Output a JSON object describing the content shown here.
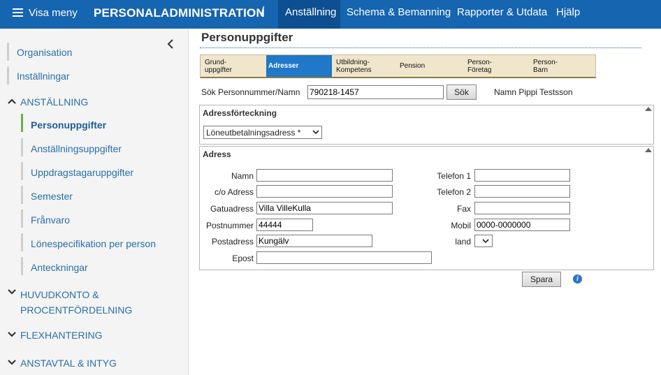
{
  "topbar": {
    "menu_label": "Visa meny",
    "app_title": "PERSONALADMINISTRATION",
    "separator": "/",
    "nav": [
      "Anställning",
      "Schema & Bemanning",
      "Rapporter & Utdata",
      "Hjälp"
    ],
    "active_nav": "Anställning"
  },
  "sidebar": {
    "top_items": [
      "Organisation",
      "Inställningar"
    ],
    "section_anstallning": "ANSTÄLLNING",
    "anstallning_items": [
      "Personuppgifter",
      "Anställningsuppgifter",
      "Uppdragstagaruppgifter",
      "Semester",
      "Frånvaro",
      "Lönespecifikation per person",
      "Anteckningar"
    ],
    "active_item": "Personuppgifter",
    "section_huvudkonto_1": "HUVUDKONTO &",
    "section_huvudkonto_2": "PROCENTFÖRDELNING",
    "section_flex": "FLEXHANTERING",
    "section_anstavtal": "ANSTAVTAL & INTYG"
  },
  "main": {
    "title": "Personuppgifter",
    "tabs": [
      {
        "l1": "Grund-",
        "l2": "uppgifter"
      },
      {
        "l1": "Adresser",
        "l2": ""
      },
      {
        "l1": "Utbildning-",
        "l2": "Kompetens"
      },
      {
        "l1": "Pension",
        "l2": ""
      },
      {
        "l1": "Person-",
        "l2": "Företag"
      },
      {
        "l1": "Person-",
        "l2": "Barn"
      }
    ],
    "active_tab": "Adresser",
    "search": {
      "label": "Sök Personnummer/Namn",
      "value": "790218-1457",
      "button": "Sök",
      "name_label": "Namn",
      "name_value": "Pippi Testsson"
    },
    "address_list": {
      "title": "Adressförteckning",
      "selected": "Löneutbetalningsadress *"
    },
    "address": {
      "title": "Adress",
      "fields": {
        "namn": {
          "label": "Namn",
          "value": ""
        },
        "co": {
          "label": "c/o Adress",
          "value": ""
        },
        "gatuadress": {
          "label": "Gatuadress",
          "value": "Villa VilleKulla"
        },
        "postnummer": {
          "label": "Postnummer",
          "value": "44444"
        },
        "postadress": {
          "label": "Postadress",
          "value": "Kungälv"
        },
        "epost": {
          "label": "Epost",
          "value": ""
        },
        "telefon1": {
          "label": "Telefon 1",
          "value": ""
        },
        "telefon2": {
          "label": "Telefon 2",
          "value": ""
        },
        "fax": {
          "label": "Fax",
          "value": ""
        },
        "mobil": {
          "label": "Mobil",
          "value": "0000-0000000"
        },
        "land": {
          "label": "land",
          "value": ""
        }
      }
    },
    "save_button": "Spara",
    "info_icon": "i"
  },
  "colors": {
    "topbar": "#1565b0",
    "active_nav": "#0d4f91",
    "active_tab": "#1f78c8",
    "sidebar_active_bar": "#6ab04c",
    "link": "#2a6ea8"
  }
}
